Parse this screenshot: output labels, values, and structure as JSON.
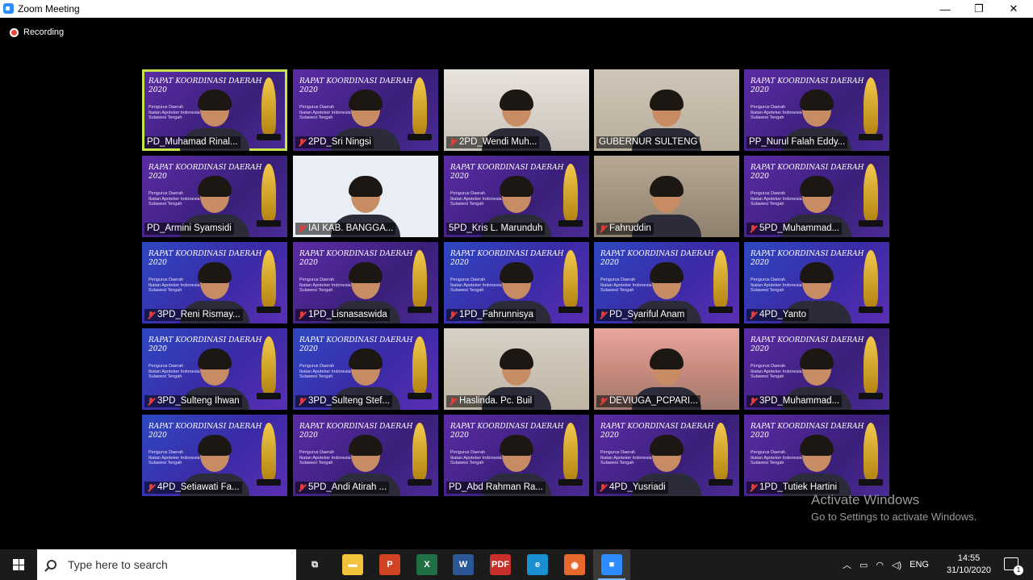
{
  "window": {
    "title": "Zoom Meeting",
    "min": "—",
    "max": "❐",
    "close": "✕"
  },
  "recording": {
    "label": "Recording"
  },
  "banner": {
    "title": "RAPAT KOORDINASI DAERAH",
    "year": "2020",
    "sub_lines": [
      "Pengurus Daerah",
      "Ikatan Apoteker Indonesia",
      "Sulawesi Tengah"
    ]
  },
  "participants": [
    {
      "name": "PD_Muhamad Rinal...",
      "muted": false,
      "active": true,
      "bg": "purple",
      "banner": true
    },
    {
      "name": "2PD_Sri Ningsi",
      "muted": true,
      "bg": "purple",
      "banner": true
    },
    {
      "name": "2PD_Wendi Muh...",
      "muted": true,
      "bg": "office",
      "banner": false
    },
    {
      "name": "GUBERNUR SULTENG",
      "muted": false,
      "bg": "room",
      "banner": false
    },
    {
      "name": "PP_Nurul Falah Eddy...",
      "muted": false,
      "bg": "purple",
      "banner": true
    },
    {
      "name": "PD_Armini Syamsidi",
      "muted": false,
      "bg": "purple",
      "banner": true
    },
    {
      "name": "IAI KAB. BANGGA...",
      "muted": true,
      "bg": "white",
      "banner": false
    },
    {
      "name": "5PD_Kris L. Marunduh",
      "muted": false,
      "bg": "purple",
      "banner": true
    },
    {
      "name": "Fahruddin",
      "muted": true,
      "bg": "beige",
      "banner": false
    },
    {
      "name": "5PD_Muhammad...",
      "muted": true,
      "bg": "purple",
      "banner": true
    },
    {
      "name": "3PD_Reni Rismay...",
      "muted": true,
      "bg": "blue",
      "banner": true
    },
    {
      "name": "1PD_Lisnasaswida",
      "muted": true,
      "bg": "purple",
      "banner": true
    },
    {
      "name": "1PD_Fahrunnisya",
      "muted": true,
      "bg": "blue",
      "banner": true
    },
    {
      "name": "PD_Syariful Anam",
      "muted": true,
      "bg": "blue",
      "banner": true
    },
    {
      "name": "4PD_Yanto",
      "muted": true,
      "bg": "blue",
      "banner": true
    },
    {
      "name": "3PD_Sulteng Ihwan",
      "muted": true,
      "bg": "blue",
      "banner": true
    },
    {
      "name": "3PD_Sulteng Stef...",
      "muted": true,
      "bg": "blue",
      "banner": true
    },
    {
      "name": "Haslinda. Pc. Buil",
      "muted": true,
      "bg": "shelf",
      "banner": false
    },
    {
      "name": "DEVIUGA_PCPARI...",
      "muted": true,
      "bg": "sunset",
      "banner": false
    },
    {
      "name": "3PD_Muhammad...",
      "muted": true,
      "bg": "purple",
      "banner": true
    },
    {
      "name": "4PD_Setiawati Fa...",
      "muted": true,
      "bg": "blue",
      "banner": true
    },
    {
      "name": "5PD_Andi Atirah ...",
      "muted": true,
      "bg": "purple",
      "banner": true
    },
    {
      "name": "PD_Abd Rahman Ra...",
      "muted": false,
      "bg": "purple",
      "banner": true
    },
    {
      "name": "4PD_Yusriadi",
      "muted": true,
      "bg": "purple",
      "banner": true
    },
    {
      "name": "1PD_Tutiek Hartini",
      "muted": true,
      "bg": "purple",
      "banner": true
    }
  ],
  "watermark": {
    "title": "Activate Windows",
    "subtitle": "Go to Settings to activate Windows."
  },
  "taskbar": {
    "search_placeholder": "Type here to search",
    "apps": [
      {
        "name": "task-view-icon",
        "glyph": "⧉",
        "color": "#1b1b1b"
      },
      {
        "name": "file-explorer-icon",
        "glyph": "▬",
        "color": "#f2c23b"
      },
      {
        "name": "powerpoint-icon",
        "glyph": "P",
        "color": "#d04423"
      },
      {
        "name": "excel-icon",
        "glyph": "X",
        "color": "#1f7145"
      },
      {
        "name": "word-icon",
        "glyph": "W",
        "color": "#2b5797"
      },
      {
        "name": "pdf-icon",
        "glyph": "PDF",
        "color": "#c9302c"
      },
      {
        "name": "edge-icon",
        "glyph": "e",
        "color": "#1a8fd1"
      },
      {
        "name": "firefox-icon",
        "glyph": "◉",
        "color": "#e8692d"
      },
      {
        "name": "zoom-icon",
        "glyph": "■",
        "color": "#2d8cff"
      }
    ],
    "tray": {
      "language": "ENG",
      "time": "14:55",
      "date": "31/10/2020",
      "notifications": "1"
    }
  }
}
